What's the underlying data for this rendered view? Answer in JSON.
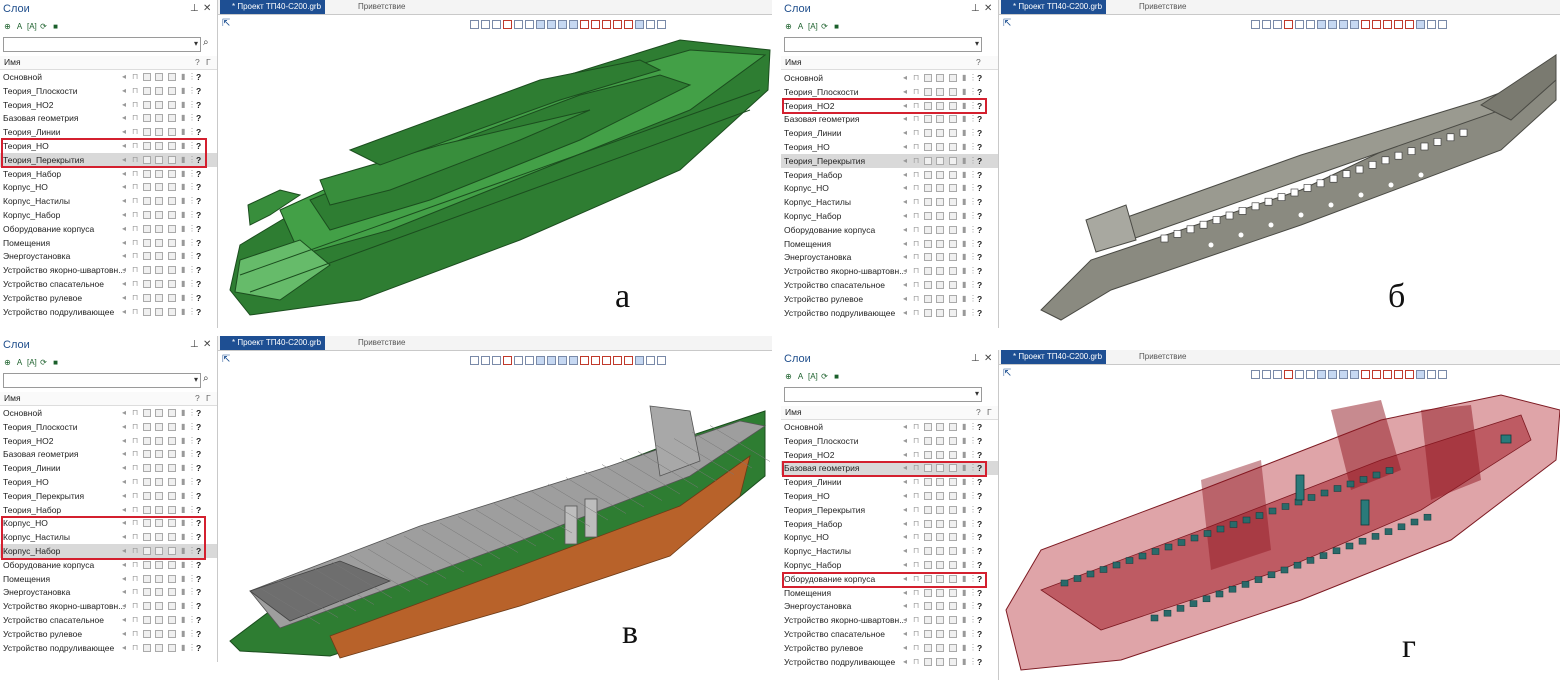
{
  "panel": {
    "title": "Слои",
    "pin_icon": "pin-icon",
    "close_icon": "✕",
    "name_column": "Имя"
  },
  "document": {
    "tab_project": "* Проект ТП40-С200.grb",
    "tab_welcome": "Приветствие"
  },
  "layers": [
    "Основной",
    "Теория_Плоскости",
    "Теория_НО2",
    "Базовая геометрия",
    "Теория_Линии",
    "Теория_НО",
    "Теория_Перекрытия",
    "Теория_Набор",
    "Корпус_НО",
    "Корпус_Настилы",
    "Корпус_Набор",
    "Оборудование корпуса",
    "Помещения",
    "Энергоустановка",
    "Устройство якорно-швартовн...",
    "Устройство спасательное",
    "Устройство рулевое",
    "Устройство подруливающее"
  ],
  "layers_b": [
    "Основной",
    "Теория_Плоскости",
    "Теория_НО2",
    "Базовая геометрия",
    "Теория_Линии",
    "Теория_НО",
    "Теория_Перекрытия",
    "Теория_Набор",
    "Корпус_НО",
    "Корпус_Настилы",
    "Корпус_Набор",
    "Оборудование корпуса",
    "Помещения",
    "Энергоустановка",
    "Устройство якорно-швартовн...",
    "Устройство спасательное",
    "Устройство рулевое",
    "Устройство подруливающее"
  ],
  "quadrants": {
    "a": {
      "letter": "а"
    },
    "b": {
      "letter": "б"
    },
    "v": {
      "letter": "в"
    },
    "g": {
      "letter": "г"
    }
  },
  "colors": {
    "hull_green": "#2e7d32",
    "hull_gray": "#8a8a80",
    "hull_red": "#a31f2a",
    "highlight": "#d4202f",
    "tab_blue": "#1e4f93"
  }
}
